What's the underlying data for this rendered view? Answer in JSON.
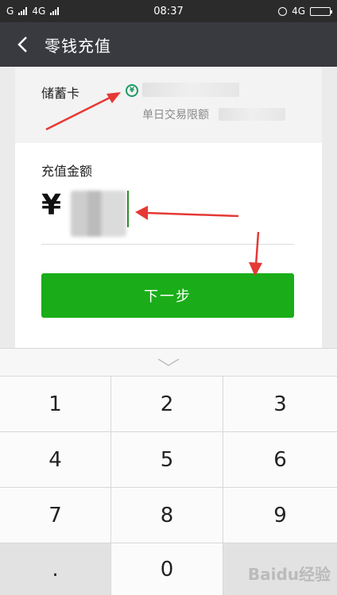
{
  "status_bar": {
    "carrier_left_1": "G",
    "carrier_left_2": "4G",
    "time": "08:37",
    "network_right": "4G"
  },
  "header": {
    "title": "零钱充值"
  },
  "card": {
    "label": "储蓄卡",
    "limit_label": "单日交易限额"
  },
  "amount": {
    "label": "充值金额",
    "currency": "¥",
    "next_label": "下一步"
  },
  "keypad": {
    "keys": [
      "1",
      "2",
      "3",
      "4",
      "5",
      "6",
      "7",
      "8",
      "9",
      ".",
      "0",
      ""
    ]
  },
  "watermark": "Baidu经验",
  "colors": {
    "accent_green": "#1aad19",
    "title_bar": "#393a3f",
    "annotation_red": "#e53935"
  }
}
